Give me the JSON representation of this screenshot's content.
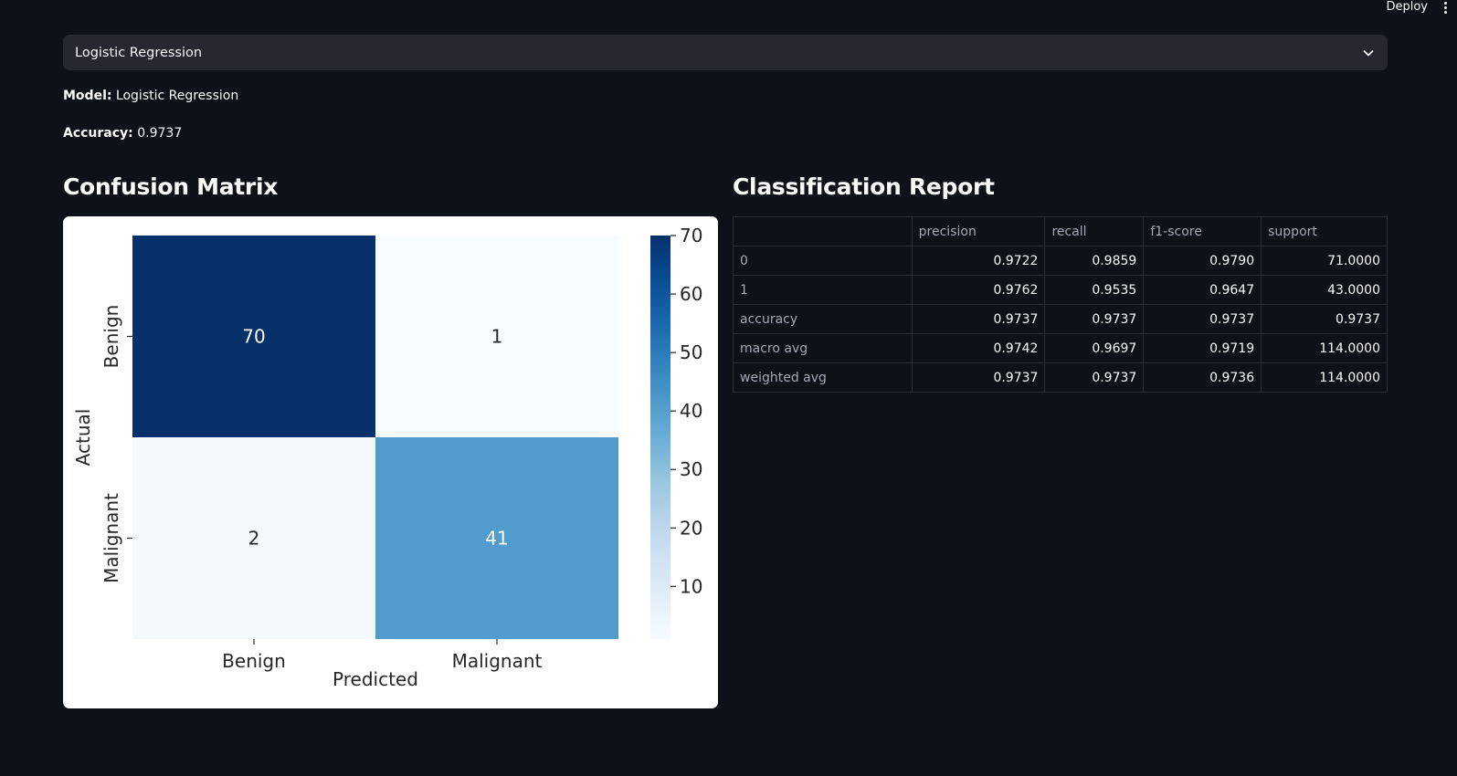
{
  "header": {
    "deploy_label": "Deploy"
  },
  "model_select": {
    "value": "Logistic Regression"
  },
  "info": {
    "model_label": "Model:",
    "model_value": "Logistic Regression",
    "accuracy_label": "Accuracy:",
    "accuracy_value": "0.9737"
  },
  "sections": {
    "confusion_title": "Confusion Matrix",
    "report_title": "Classification Report"
  },
  "chart_data": {
    "type": "heatmap",
    "title": "",
    "x_labels": [
      "Benign",
      "Malignant"
    ],
    "y_labels": [
      "Benign",
      "Malignant"
    ],
    "xlabel": "Predicted",
    "ylabel": "Actual",
    "values": [
      [
        70,
        1
      ],
      [
        2,
        41
      ]
    ],
    "colormap": "Blues",
    "colorbar": {
      "min": 1,
      "max": 70,
      "ticks": [
        10,
        20,
        30,
        40,
        50,
        60,
        70
      ]
    }
  },
  "report": {
    "columns": [
      "",
      "precision",
      "recall",
      "f1-score",
      "support"
    ],
    "rows": [
      {
        "label": "0",
        "values": [
          "0.9722",
          "0.9859",
          "0.9790",
          "71.0000"
        ]
      },
      {
        "label": "1",
        "values": [
          "0.9762",
          "0.9535",
          "0.9647",
          "43.0000"
        ]
      },
      {
        "label": "accuracy",
        "values": [
          "0.9737",
          "0.9737",
          "0.9737",
          "0.9737"
        ]
      },
      {
        "label": "macro avg",
        "values": [
          "0.9742",
          "0.9697",
          "0.9719",
          "114.0000"
        ]
      },
      {
        "label": "weighted avg",
        "values": [
          "0.9737",
          "0.9737",
          "0.9736",
          "114.0000"
        ]
      }
    ]
  }
}
